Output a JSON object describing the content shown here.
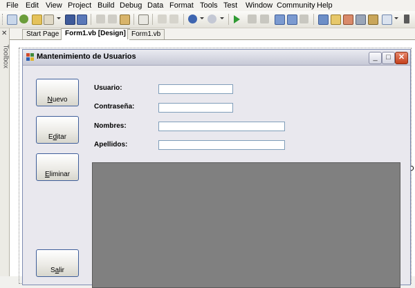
{
  "menu": {
    "items": [
      "File",
      "Edit",
      "View",
      "Project",
      "Build",
      "Debug",
      "Data",
      "Format",
      "Tools",
      "Test",
      "Window",
      "Community",
      "Help"
    ]
  },
  "toolbox": {
    "label": "Toolbox"
  },
  "tabs": [
    "Start Page",
    "Form1.vb [Design]",
    "Form1.vb"
  ],
  "form": {
    "title": "Mantenimiento de Usuarios",
    "buttons": {
      "nuevo_accel": "N",
      "nuevo_rest": "uevo",
      "editar_pre": "E",
      "editar_accel": "d",
      "editar_rest": "itar",
      "eliminar_accel": "E",
      "eliminar_rest": "liminar",
      "salir_pre": "S",
      "salir_accel": "a",
      "salir_rest": "lir"
    },
    "labels": {
      "usuario": "Usuario:",
      "contrasena": "Contraseña:",
      "nombres": "Nombres:",
      "apellidos": "Apellidos:"
    },
    "fields": {
      "usuario": "",
      "contrasena": "",
      "nombres": "",
      "apellidos": ""
    }
  },
  "colors": {
    "grid_background": "#808080",
    "form_background": "#e9e8ee",
    "close_button": "#c4401c"
  }
}
